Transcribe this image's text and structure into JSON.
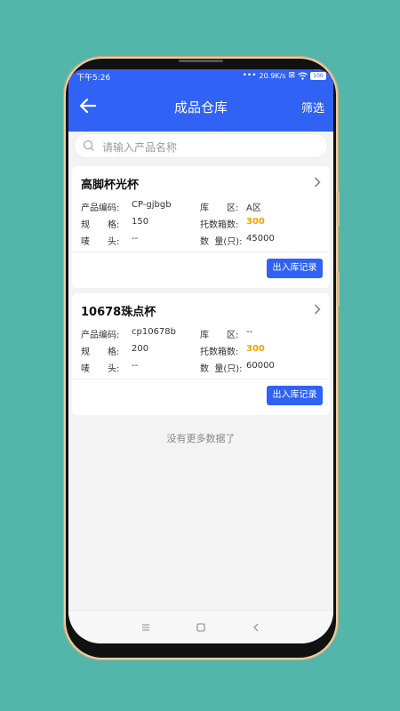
{
  "status_bar": {
    "time": "下午5:26",
    "network_speed": "20.9K/s",
    "battery_level": "100"
  },
  "header": {
    "title": "成品仓库",
    "filter_label": "筛选",
    "back_icon": "arrow-left-icon"
  },
  "search": {
    "placeholder": "请输入产品名称"
  },
  "products": [
    {
      "name": "高脚杯光杯",
      "code_label": "产品编码:",
      "code_value": "CP-gjbgb",
      "spec_label": "规　　格:",
      "spec_value": "150",
      "mark_label": "唛　　头:",
      "mark_value": "--",
      "area_label": "库　　区:",
      "area_value": "A区",
      "boxes_label": "托数箱数:",
      "boxes_value": "300",
      "qty_label": "数  量(只):",
      "qty_value": "45000",
      "button_label": "出入库记录"
    },
    {
      "name": "10678珠点杯",
      "code_label": "产品编码:",
      "code_value": "cp10678b",
      "spec_label": "规　　格:",
      "spec_value": "200",
      "mark_label": "唛　　头:",
      "mark_value": "--",
      "area_label": "库　　区:",
      "area_value": "--",
      "boxes_label": "托数箱数:",
      "boxes_value": "300",
      "qty_label": "数  量(只):",
      "qty_value": "60000",
      "button_label": "出入库记录"
    }
  ],
  "footer_text": "没有更多数据了",
  "colors": {
    "primary": "#2f62f5",
    "highlight": "#f0a400",
    "background": "#53b6aa"
  }
}
